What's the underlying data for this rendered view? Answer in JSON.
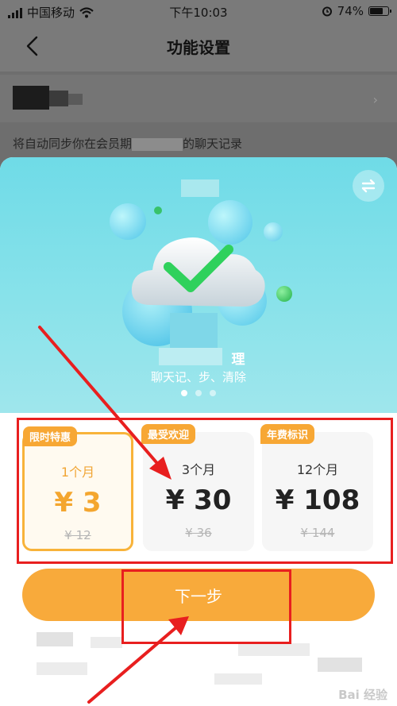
{
  "status_bar": {
    "carrier": "中国移动",
    "time": "下午10:03",
    "battery": "74%",
    "battery_level": 0.74
  },
  "nav": {
    "title": "功能设置"
  },
  "setting": {
    "description_start": "将自动同步你在会员期",
    "description_end": "的聊天记录"
  },
  "banner": {
    "title": "理",
    "subtitle": "聊天记、步、清除",
    "icon": "swap-icon",
    "page_count": 3,
    "active_page": 1
  },
  "plans": [
    {
      "badge": "限时特惠",
      "duration": "1个月",
      "price": "¥ 3",
      "original_price": "¥ 12",
      "selected": true
    },
    {
      "badge": "最受欢迎",
      "duration": "3个月",
      "price": "¥ 30",
      "original_price": "¥ 36",
      "selected": false
    },
    {
      "badge": "年费标识",
      "duration": "12个月",
      "price": "¥ 108",
      "original_price": "¥ 144",
      "selected": false
    }
  ],
  "next_button": {
    "label": "下一步"
  },
  "watermark": "Bai 经验",
  "colors": {
    "accent": "#f8aa3b",
    "banner": "#7ddde8",
    "annotation": "#e81f1f"
  }
}
